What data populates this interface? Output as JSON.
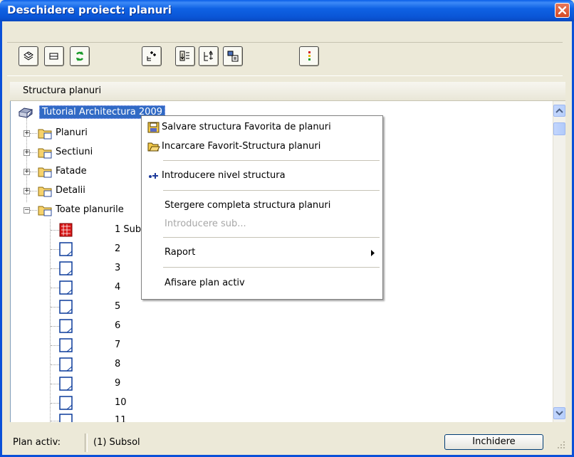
{
  "window": {
    "title": "Deschidere proiect: planuri"
  },
  "header": {
    "column_label": "Structura planuri"
  },
  "tree": {
    "root_label": "Tutorial Architectura 2009",
    "folders": [
      {
        "label": "Planuri",
        "expanded": false
      },
      {
        "label": "Sectiuni",
        "expanded": false
      },
      {
        "label": "Fatade",
        "expanded": false
      },
      {
        "label": "Detalii",
        "expanded": false
      },
      {
        "label": "Toate planurile",
        "expanded": true
      }
    ],
    "plans": [
      {
        "label": "1 Subsol",
        "active": true
      },
      {
        "label": "2"
      },
      {
        "label": "3"
      },
      {
        "label": "4"
      },
      {
        "label": "5"
      },
      {
        "label": "6"
      },
      {
        "label": "7"
      },
      {
        "label": "8"
      },
      {
        "label": "9"
      },
      {
        "label": "10"
      },
      {
        "label": "11"
      }
    ]
  },
  "context_menu": {
    "items": [
      {
        "label": "Salvare structura Favorita de planuri",
        "icon": "save-icon",
        "enabled": true
      },
      {
        "label": "Incarcare Favorit-Structura planuri",
        "icon": "open-folder-icon",
        "enabled": true
      },
      {
        "label": "Introducere nivel structura",
        "icon": "insert-level-icon",
        "enabled": true
      },
      {
        "label": "Stergere completa structura planuri",
        "enabled": true
      },
      {
        "label": "Introducere sub...",
        "enabled": false
      },
      {
        "label": "Raport",
        "enabled": true,
        "submenu": true
      },
      {
        "label": "Afisare plan activ",
        "enabled": true
      }
    ]
  },
  "statusbar": {
    "label": "Plan activ:",
    "value": "(1)  Subsol",
    "close_button": "Inchidere"
  },
  "colors": {
    "titlebar": "#0a55d6",
    "selection": "#316ac5",
    "folder": "#f7d26a"
  }
}
